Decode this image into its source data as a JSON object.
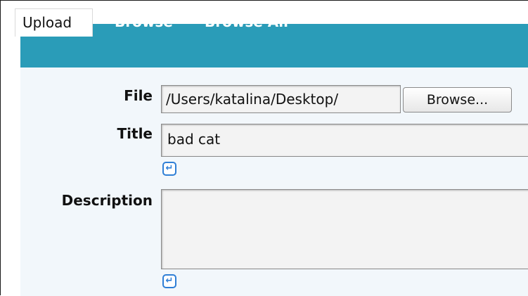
{
  "tabs": [
    {
      "label": "Upload",
      "active": true
    },
    {
      "label": "Browse",
      "active": false
    },
    {
      "label": "Browse All",
      "active": false
    }
  ],
  "form": {
    "file_label": "File",
    "file_value": "/Users/katalina/Desktop/",
    "browse_button": "Browse...",
    "title_label": "Title",
    "title_value": "bad cat",
    "description_label": "Description",
    "description_value": ""
  },
  "icons": {
    "enter": "↵"
  },
  "colors": {
    "tabbar": "#2a9cb8",
    "content_bg": "#f2f7fb",
    "icon_blue": "#2f7fd6"
  }
}
